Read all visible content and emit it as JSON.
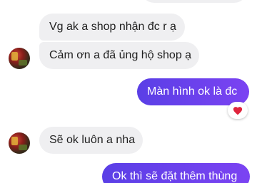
{
  "conversation": {
    "messages": [
      {
        "sender": "shop",
        "text": "Vg ak a shop nhận đc r ạ"
      },
      {
        "sender": "shop",
        "text": "Cảm ơn a đã ủng hộ shop ạ"
      },
      {
        "sender": "me",
        "text": "Màn hình ok là đc",
        "reaction": "heart"
      },
      {
        "sender": "shop",
        "text": "Sẽ ok luôn a nha"
      },
      {
        "sender": "me",
        "text": "Ok thì sẽ đặt thêm thùng"
      }
    ]
  },
  "colors": {
    "outgoing_bubble": "#6a3ef0",
    "incoming_bubble": "#efeff1",
    "reaction_heart": "#e0243c"
  }
}
